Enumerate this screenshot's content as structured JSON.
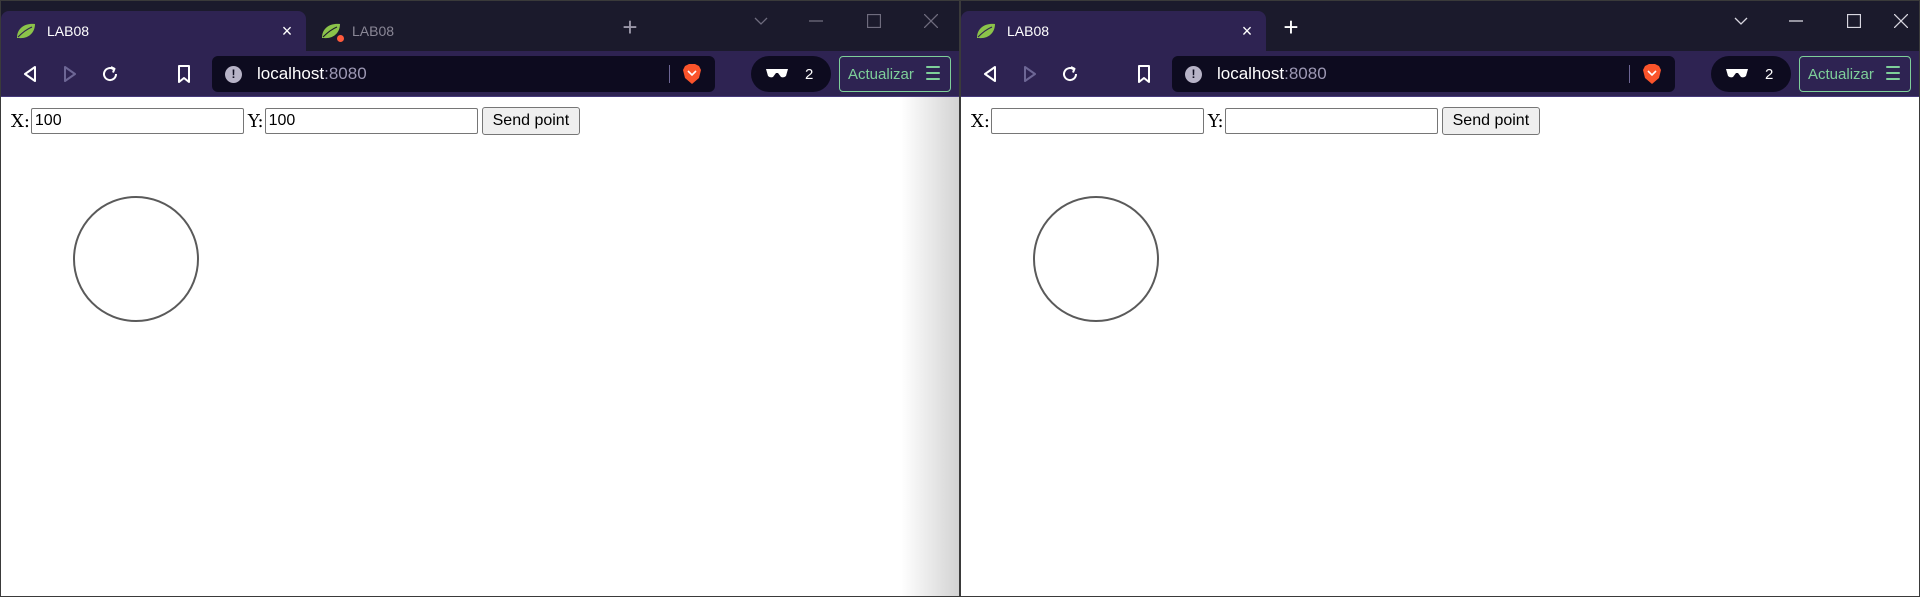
{
  "windows": [
    {
      "tabs": [
        {
          "title": "LAB08",
          "active": true,
          "close": "×"
        },
        {
          "title": "LAB08",
          "active": false,
          "recording_dot": true
        }
      ],
      "newtab": "+",
      "url": {
        "host": "localhost",
        "port": ":8080"
      },
      "private_count": "2",
      "update_label": "Actualizar",
      "form": {
        "x_label": "X:",
        "x_value": "100",
        "y_label": "Y:",
        "y_value": "100",
        "send_label": "Send point"
      }
    },
    {
      "tabs": [
        {
          "title": "LAB08",
          "active": true,
          "close": "×"
        }
      ],
      "newtab": "+",
      "url": {
        "host": "localhost",
        "port": ":8080"
      },
      "private_count": "2",
      "update_label": "Actualizar",
      "form": {
        "x_label": "X:",
        "x_value": "",
        "y_label": "Y:",
        "y_value": "",
        "send_label": "Send point"
      }
    }
  ],
  "colors": {
    "accent": "#2e2352",
    "titlebar": "#1b1a2c",
    "update_green": "#7ecf9a"
  }
}
